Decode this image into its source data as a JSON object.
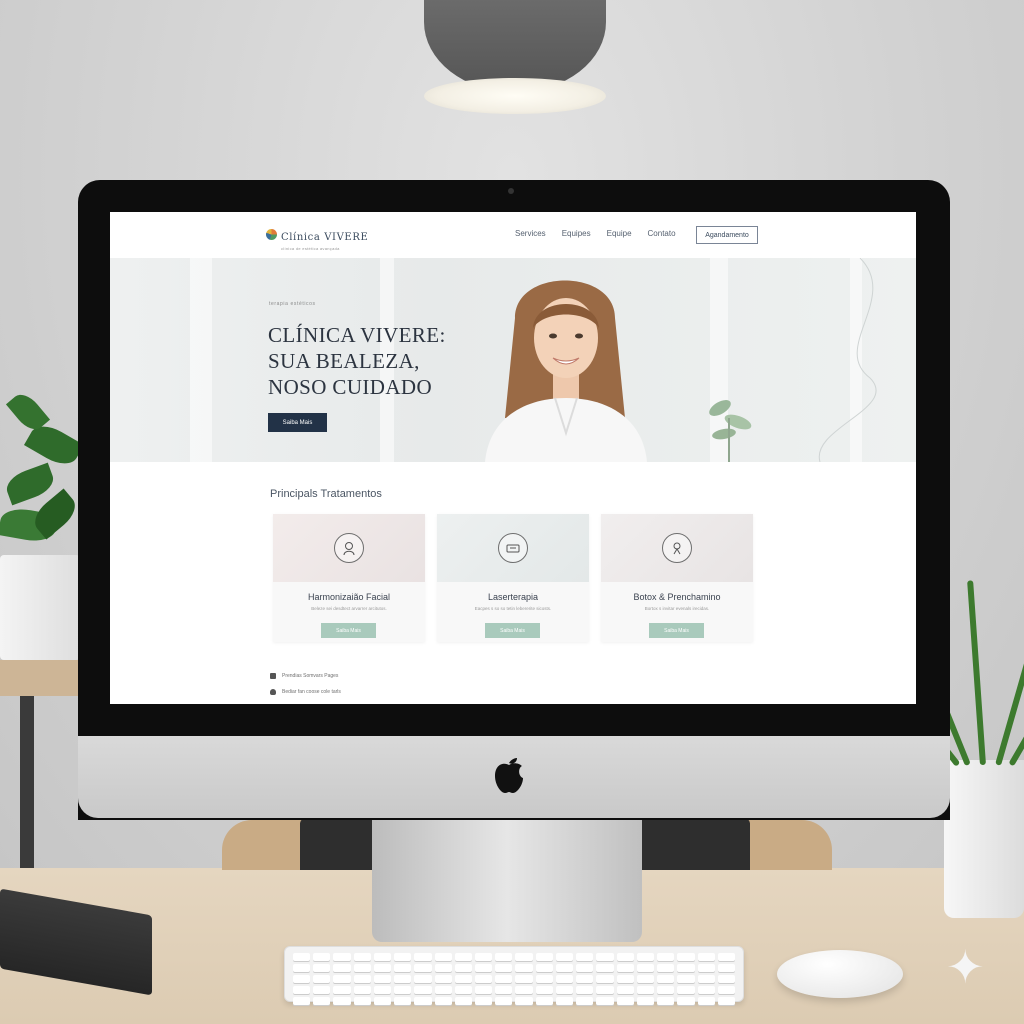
{
  "nav": {
    "logo_text": "Clínica VIVERE",
    "logo_tagline": "clínica de estética avançada",
    "links": [
      "Services",
      "Equipes",
      "Equipe",
      "Contato"
    ],
    "cta": "Agandamento"
  },
  "hero": {
    "eyebrow": "terapia estéticos",
    "title_lines": [
      "CLÍNICA VIVERE:",
      "SUA BEALEZA,",
      "NOSO CUIDADO"
    ],
    "button": "Saiba Mais"
  },
  "treatments": {
    "heading": "Principals Tratamentos",
    "cards": [
      {
        "icon": "face-icon",
        "title": "Harmonizaião Facial",
        "desc": "Beleze sei desdtect arvarrer arcitutos.",
        "button": "Saiba Mais"
      },
      {
        "icon": "laser-icon",
        "title": "Laserterapia",
        "desc": "Eacpes s so so tetin lebererite sicosts.",
        "button": "Saiba Mais"
      },
      {
        "icon": "botox-icon",
        "title": "Botox & Prenchamino",
        "desc": "Bortox s invitar evenals irecidas.",
        "button": "Saiba Mais"
      }
    ]
  },
  "footer": {
    "line1": "Prendias Somvars Pages",
    "line2": "Bediar  fan  coose cole tarls"
  },
  "colors": {
    "primary_dark": "#223247",
    "accent_mint": "#a9cabc",
    "text_dark": "#2c3440"
  }
}
